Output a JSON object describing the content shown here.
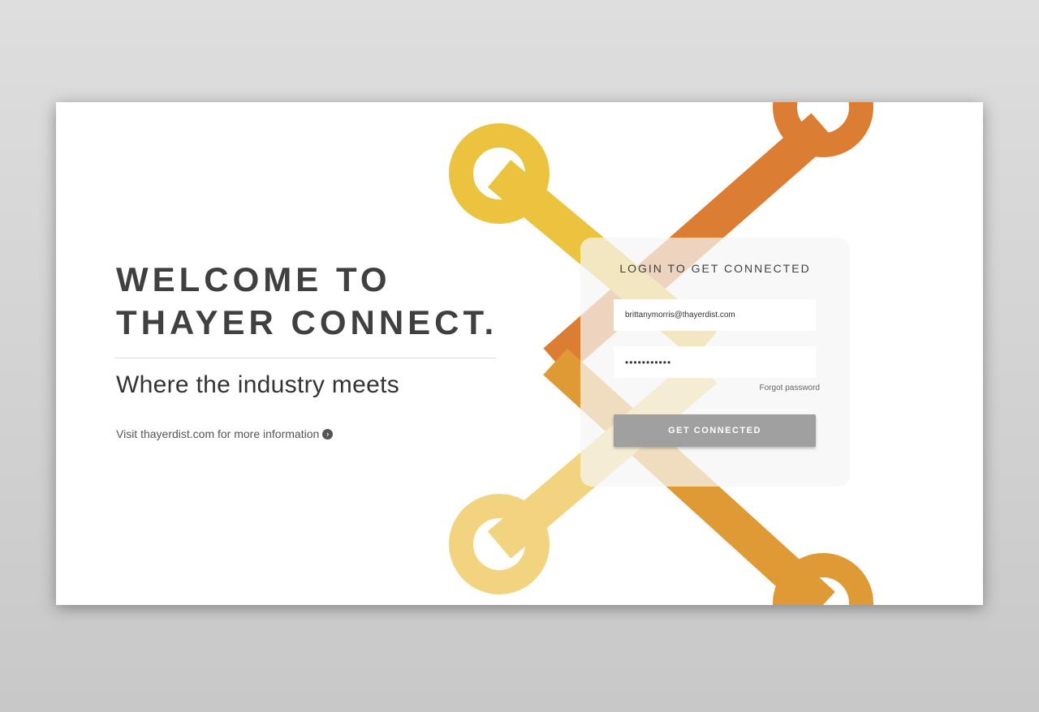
{
  "welcome": {
    "line1": "WELCOME TO",
    "line2": "THAYER CONNECT."
  },
  "tagline": "Where the industry meets",
  "visit_link": {
    "label": "Visit thayerdist.com for more information",
    "icon": "chevron-right-circle-icon"
  },
  "login": {
    "title": "LOGIN TO GET CONNECTED",
    "email_value": "brittanymorris@thayerdist.com",
    "password_value": "•••••••••••",
    "forgot_label": "Forgot password",
    "submit_label": "GET CONNECTED"
  },
  "colors": {
    "yellow": "#ecc33f",
    "yellow_light": "#f2d37f",
    "orange": "#db7d32",
    "orange_light": "#e09a35",
    "button": "#a0a0a0",
    "heading": "#404040"
  }
}
